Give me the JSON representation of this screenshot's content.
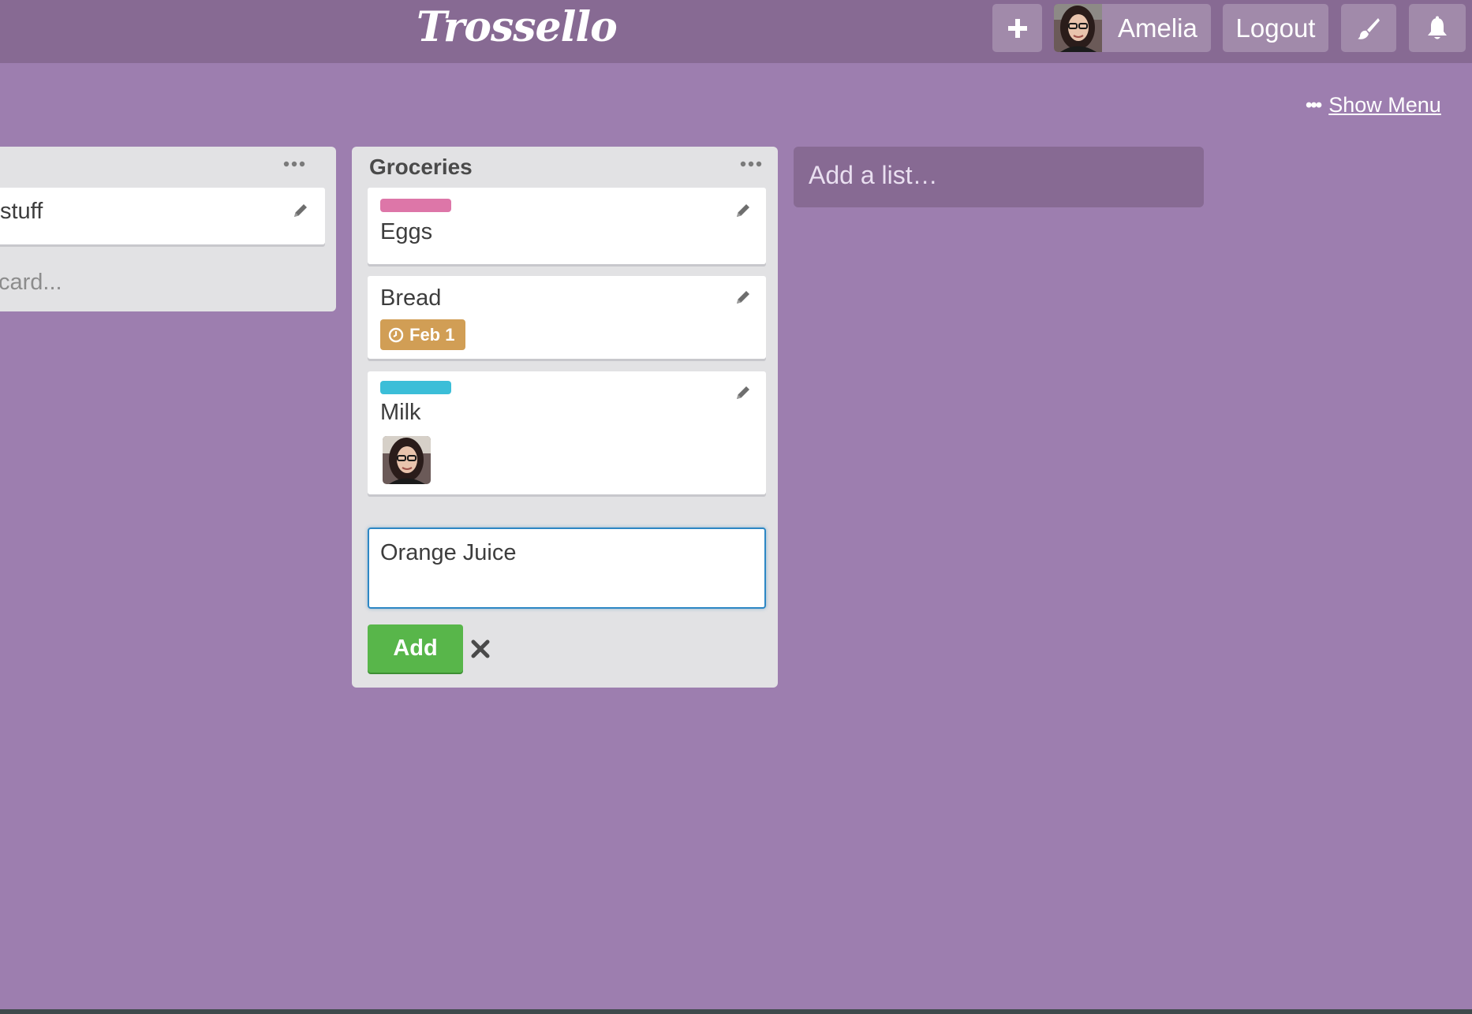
{
  "header": {
    "logo": "Trossello",
    "add_icon": "plus-icon",
    "user_name": "Amelia",
    "logout_label": "Logout",
    "theme_icon": "paintbrush-icon",
    "notifications_icon": "bell-icon"
  },
  "board": {
    "show_menu_label": "Show Menu",
    "add_list_placeholder": "Add a list…"
  },
  "lists": [
    {
      "title": "",
      "cards": [
        {
          "text": "stuff"
        }
      ],
      "add_card_label": "card..."
    },
    {
      "title": "Groceries",
      "cards": [
        {
          "text": "Eggs",
          "label_color": "#dd76a8"
        },
        {
          "text": "Bread",
          "due": "Feb 1",
          "due_color": "#d19e55"
        },
        {
          "text": "Milk",
          "label_color": "#3bbed8"
        }
      ],
      "composer_value": "Orange Juice",
      "add_button_label": "Add"
    }
  ],
  "colors": {
    "background": "#9d7eaf",
    "header": "#876a93",
    "list": "#e2e2e4",
    "add_button": "#58b64a",
    "focus_border": "#2d87c4"
  }
}
